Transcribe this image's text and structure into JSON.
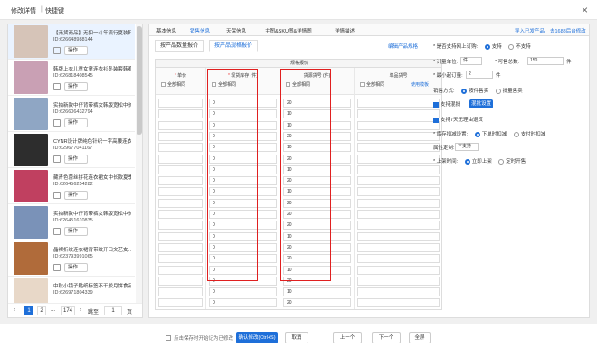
{
  "titlebar": {
    "title": "修改详情",
    "sep": "|",
    "shortcut": "快捷键",
    "close": "×"
  },
  "products": [
    {
      "name": "【无货商品】无扣一斗年流行夏装韩…",
      "id": "ID:626648988144",
      "op": "操作",
      "color": "#d6c4b8",
      "selected": true
    },
    {
      "name": "韩版上衣儿童女童连衣衫冬装套韩春…",
      "id": "ID:626818408545",
      "op": "操作",
      "color": "#c9a0b4"
    },
    {
      "name": "实拍新款中仔背带裤女韩版宽松中长…",
      "id": "ID:626606432794",
      "op": "操作",
      "color": "#8fa6c4"
    },
    {
      "name": "CYNR设计牌纯色针织一字高腰连衣…",
      "id": "ID:629677041167",
      "op": "操作",
      "color": "#2d2d2d"
    },
    {
      "name": "藏青色蕾丝拼花连衣裙女中长款夏季…",
      "id": "ID:626456254282",
      "op": "操作",
      "color": "#c04060"
    },
    {
      "name": "实拍新款中仔背带裤女韩版宽松中长…",
      "id": "ID:626451610835",
      "op": "操作",
      "color": "#7a92b8"
    },
    {
      "name": "晶裸折纹连衣裙背带纹开口文艺女…",
      "id": "ID:623793991065",
      "op": "操作",
      "color": "#b06b3a"
    },
    {
      "name": "中秋小镜子贴纸标签不干胶月饼食品…",
      "id": "ID:626971804339",
      "op": "",
      "color": "#e8d8c8"
    }
  ],
  "pager": {
    "prev": "‹",
    "p1": "1",
    "p2": "2",
    "dots": "...",
    "last": "174",
    "next": "›",
    "jump": "跳至",
    "jump_value": "1",
    "unit": "页"
  },
  "tabs": [
    "基本信息",
    "销售信息",
    "天保信息",
    "主图&SKU图&详情图",
    "详情描述"
  ],
  "tab_links": {
    "imported": "导入已发产品",
    "platform": "去1688后台修改"
  },
  "subtabs": [
    "按产品数量报价",
    "按产品规格报价"
  ],
  "edit_spec_link": "编辑产品规格",
  "spec_header": "规格报价",
  "columns": [
    {
      "label": "单价",
      "required": true,
      "check": "全部相同",
      "use": ""
    },
    {
      "label": "现货库存 (件)",
      "required": true,
      "check": "全部相同",
      "use": ""
    },
    {
      "label": "货源货号 (件)",
      "required": false,
      "check": "全部相同",
      "use": ""
    },
    {
      "label": "单品货号",
      "required": false,
      "check": "全部相同",
      "use": "使用模板"
    }
  ],
  "stock_values": [
    "0",
    "0",
    "0",
    "0",
    "0",
    "0",
    "0",
    "0",
    "0",
    "0",
    "0",
    "0",
    "0",
    "0",
    "0",
    "0",
    "0",
    "0",
    "0"
  ],
  "source_values": [
    "20",
    "10",
    "10",
    "20",
    "10",
    "20",
    "10",
    "20",
    "10",
    "20",
    "20",
    "20",
    "10",
    "20",
    "20",
    "10",
    "20",
    "10",
    "20"
  ],
  "settings": {
    "support_label": "* 是否支持网上订购:",
    "support_yes": "支持",
    "support_no": "不支持",
    "unit_label": "* 计量单位:",
    "unit_value": "件",
    "stock_label": "* 可售总数:",
    "stock_value": "150",
    "stock_unit": "件",
    "min_label": "* 最小起订量:",
    "min_value": "2",
    "min_unit": "件",
    "sale_label": "销售方式:",
    "sale_opt1": "按件售卖",
    "sale_opt2": "批量售卖",
    "mix_label": "支持混批",
    "mix_button": "混批设置",
    "return_label": "支持7天无理由退货",
    "reduce_label": "* 库存扣减设置:",
    "reduce_opt1": "下单时扣减",
    "reduce_opt2": "支付时扣减",
    "attr_label": "属性定制:",
    "attr_value": "不支持",
    "online_label": "* 上架时间:",
    "online_opt1": "立即上架",
    "online_opt2": "定时开售"
  },
  "bottom": {
    "note": "点击保存时开始记为已修改",
    "save": "确认修改(Ctrl+S)",
    "cancel": "取消",
    "prev": "上一个",
    "next": "下一个",
    "all": "全屏"
  },
  "colors": {
    "accent": "#1e6fd9",
    "highlight": "#e02020"
  }
}
